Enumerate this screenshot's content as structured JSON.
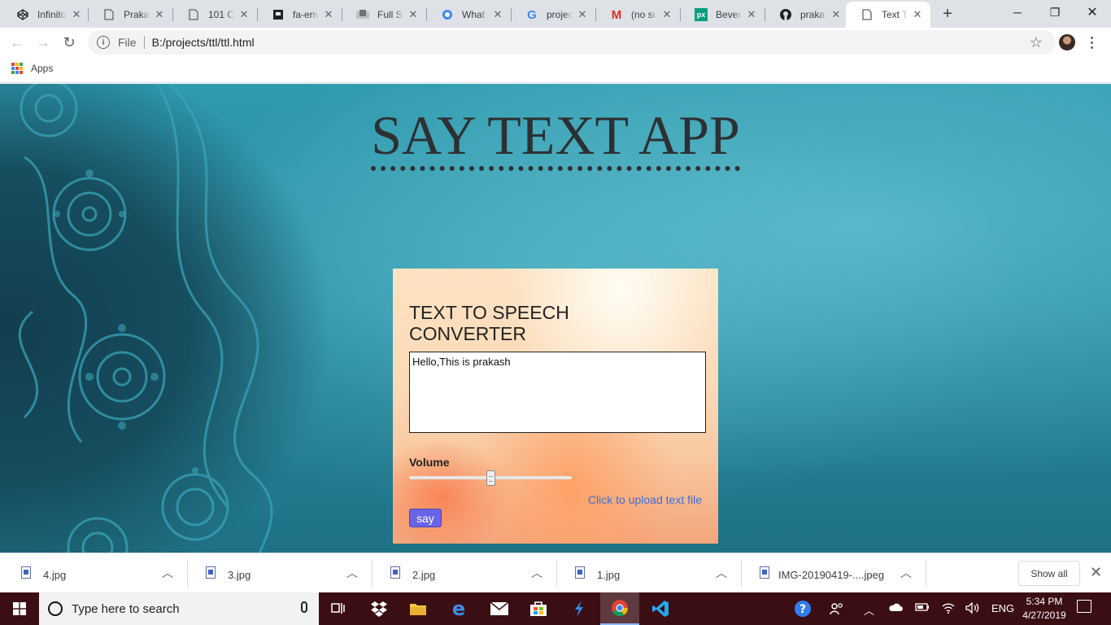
{
  "browser": {
    "tabs": [
      {
        "title": "Infinito",
        "favicon": "codepen-icon"
      },
      {
        "title": "Prakash",
        "favicon": "page-icon"
      },
      {
        "title": "101 Cat",
        "favicon": "page-icon"
      },
      {
        "title": "fa-enve",
        "favicon": "flag-icon"
      },
      {
        "title": "Full Sta",
        "favicon": "image-icon"
      },
      {
        "title": "What a",
        "favicon": "circle-icon"
      },
      {
        "title": "project",
        "favicon": "google-icon"
      },
      {
        "title": "(no sub",
        "favicon": "gmail-icon"
      },
      {
        "title": "Beverag",
        "favicon": "px-icon"
      },
      {
        "title": "prakash",
        "favicon": "github-icon"
      },
      {
        "title": "Text To",
        "favicon": "page-icon",
        "active": true
      }
    ],
    "url_scheme": "File",
    "url": "B:/projects/ttl/ttl.html",
    "bookmarks": {
      "apps_label": "Apps"
    }
  },
  "app": {
    "title": "SAY TEXT APP",
    "card_title": "TEXT TO SPEECH CONVERTER",
    "textarea_value": "Hello,This is prakash",
    "volume_label": "Volume",
    "volume_fraction": 0.5,
    "upload_link": "Click to upload text file",
    "say_button": "say"
  },
  "downloads": {
    "items": [
      "4.jpg",
      "3.jpg",
      "2.jpg",
      "1.jpg",
      "IMG-20190419-....jpeg"
    ],
    "show_all": "Show all"
  },
  "taskbar": {
    "search_placeholder": "Type here to search",
    "language": "ENG",
    "time": "5:34 PM",
    "date": "4/27/2019"
  },
  "colors": {
    "accent_button": "#6b63e6",
    "link": "#3b6fd8",
    "taskbar": "#3b0e14",
    "page_teal": "#2b8ea3"
  }
}
